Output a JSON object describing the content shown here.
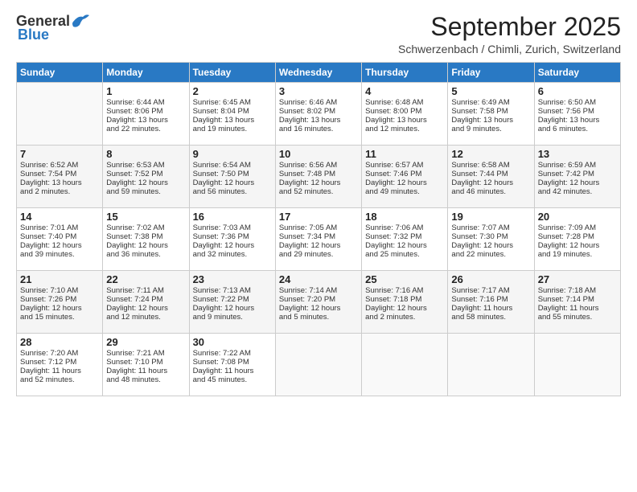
{
  "header": {
    "logo_general": "General",
    "logo_blue": "Blue",
    "month_title": "September 2025",
    "location": "Schwerzenbach / Chimli, Zurich, Switzerland"
  },
  "days_of_week": [
    "Sunday",
    "Monday",
    "Tuesday",
    "Wednesday",
    "Thursday",
    "Friday",
    "Saturday"
  ],
  "weeks": [
    [
      {
        "day": "",
        "content": ""
      },
      {
        "day": "1",
        "content": "Sunrise: 6:44 AM\nSunset: 8:06 PM\nDaylight: 13 hours\nand 22 minutes."
      },
      {
        "day": "2",
        "content": "Sunrise: 6:45 AM\nSunset: 8:04 PM\nDaylight: 13 hours\nand 19 minutes."
      },
      {
        "day": "3",
        "content": "Sunrise: 6:46 AM\nSunset: 8:02 PM\nDaylight: 13 hours\nand 16 minutes."
      },
      {
        "day": "4",
        "content": "Sunrise: 6:48 AM\nSunset: 8:00 PM\nDaylight: 13 hours\nand 12 minutes."
      },
      {
        "day": "5",
        "content": "Sunrise: 6:49 AM\nSunset: 7:58 PM\nDaylight: 13 hours\nand 9 minutes."
      },
      {
        "day": "6",
        "content": "Sunrise: 6:50 AM\nSunset: 7:56 PM\nDaylight: 13 hours\nand 6 minutes."
      }
    ],
    [
      {
        "day": "7",
        "content": "Sunrise: 6:52 AM\nSunset: 7:54 PM\nDaylight: 13 hours\nand 2 minutes."
      },
      {
        "day": "8",
        "content": "Sunrise: 6:53 AM\nSunset: 7:52 PM\nDaylight: 12 hours\nand 59 minutes."
      },
      {
        "day": "9",
        "content": "Sunrise: 6:54 AM\nSunset: 7:50 PM\nDaylight: 12 hours\nand 56 minutes."
      },
      {
        "day": "10",
        "content": "Sunrise: 6:56 AM\nSunset: 7:48 PM\nDaylight: 12 hours\nand 52 minutes."
      },
      {
        "day": "11",
        "content": "Sunrise: 6:57 AM\nSunset: 7:46 PM\nDaylight: 12 hours\nand 49 minutes."
      },
      {
        "day": "12",
        "content": "Sunrise: 6:58 AM\nSunset: 7:44 PM\nDaylight: 12 hours\nand 46 minutes."
      },
      {
        "day": "13",
        "content": "Sunrise: 6:59 AM\nSunset: 7:42 PM\nDaylight: 12 hours\nand 42 minutes."
      }
    ],
    [
      {
        "day": "14",
        "content": "Sunrise: 7:01 AM\nSunset: 7:40 PM\nDaylight: 12 hours\nand 39 minutes."
      },
      {
        "day": "15",
        "content": "Sunrise: 7:02 AM\nSunset: 7:38 PM\nDaylight: 12 hours\nand 36 minutes."
      },
      {
        "day": "16",
        "content": "Sunrise: 7:03 AM\nSunset: 7:36 PM\nDaylight: 12 hours\nand 32 minutes."
      },
      {
        "day": "17",
        "content": "Sunrise: 7:05 AM\nSunset: 7:34 PM\nDaylight: 12 hours\nand 29 minutes."
      },
      {
        "day": "18",
        "content": "Sunrise: 7:06 AM\nSunset: 7:32 PM\nDaylight: 12 hours\nand 25 minutes."
      },
      {
        "day": "19",
        "content": "Sunrise: 7:07 AM\nSunset: 7:30 PM\nDaylight: 12 hours\nand 22 minutes."
      },
      {
        "day": "20",
        "content": "Sunrise: 7:09 AM\nSunset: 7:28 PM\nDaylight: 12 hours\nand 19 minutes."
      }
    ],
    [
      {
        "day": "21",
        "content": "Sunrise: 7:10 AM\nSunset: 7:26 PM\nDaylight: 12 hours\nand 15 minutes."
      },
      {
        "day": "22",
        "content": "Sunrise: 7:11 AM\nSunset: 7:24 PM\nDaylight: 12 hours\nand 12 minutes."
      },
      {
        "day": "23",
        "content": "Sunrise: 7:13 AM\nSunset: 7:22 PM\nDaylight: 12 hours\nand 9 minutes."
      },
      {
        "day": "24",
        "content": "Sunrise: 7:14 AM\nSunset: 7:20 PM\nDaylight: 12 hours\nand 5 minutes."
      },
      {
        "day": "25",
        "content": "Sunrise: 7:16 AM\nSunset: 7:18 PM\nDaylight: 12 hours\nand 2 minutes."
      },
      {
        "day": "26",
        "content": "Sunrise: 7:17 AM\nSunset: 7:16 PM\nDaylight: 11 hours\nand 58 minutes."
      },
      {
        "day": "27",
        "content": "Sunrise: 7:18 AM\nSunset: 7:14 PM\nDaylight: 11 hours\nand 55 minutes."
      }
    ],
    [
      {
        "day": "28",
        "content": "Sunrise: 7:20 AM\nSunset: 7:12 PM\nDaylight: 11 hours\nand 52 minutes."
      },
      {
        "day": "29",
        "content": "Sunrise: 7:21 AM\nSunset: 7:10 PM\nDaylight: 11 hours\nand 48 minutes."
      },
      {
        "day": "30",
        "content": "Sunrise: 7:22 AM\nSunset: 7:08 PM\nDaylight: 11 hours\nand 45 minutes."
      },
      {
        "day": "",
        "content": ""
      },
      {
        "day": "",
        "content": ""
      },
      {
        "day": "",
        "content": ""
      },
      {
        "day": "",
        "content": ""
      }
    ]
  ]
}
